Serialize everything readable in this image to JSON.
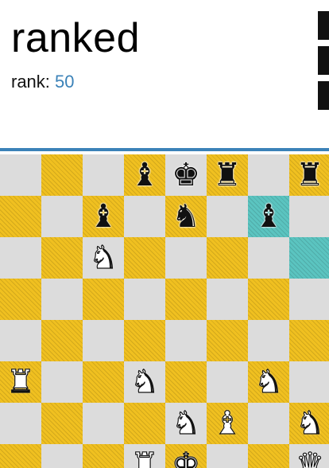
{
  "header": {
    "title": "ranked",
    "rank_label": "rank:",
    "rank_value": "50"
  },
  "colors": {
    "accent": "#3b82b8",
    "light_square": "#dcdcdc",
    "dark_square": "#f0c020",
    "highlight": "#5bc4c0"
  },
  "board": {
    "highlight_squares": [
      [
        1,
        6
      ],
      [
        2,
        7
      ]
    ],
    "pieces": [
      {
        "row": 0,
        "col": 3,
        "color": "black",
        "type": "bishop",
        "glyph": "♝",
        "icon": "black-bishop-icon"
      },
      {
        "row": 0,
        "col": 4,
        "color": "black",
        "type": "king",
        "glyph": "♚",
        "icon": "black-king-icon"
      },
      {
        "row": 0,
        "col": 5,
        "color": "black",
        "type": "rook",
        "glyph": "♜",
        "icon": "black-rook-icon"
      },
      {
        "row": 0,
        "col": 7,
        "color": "black",
        "type": "rook",
        "glyph": "♜",
        "icon": "black-rook-icon"
      },
      {
        "row": 1,
        "col": 2,
        "color": "black",
        "type": "bishop",
        "glyph": "♝",
        "icon": "black-bishop-icon"
      },
      {
        "row": 1,
        "col": 4,
        "color": "black",
        "type": "knight",
        "glyph": "♞",
        "icon": "black-knight-icon"
      },
      {
        "row": 1,
        "col": 6,
        "color": "black",
        "type": "bishop",
        "glyph": "♝",
        "icon": "black-bishop-icon"
      },
      {
        "row": 2,
        "col": 2,
        "color": "white",
        "type": "knight",
        "glyph": "♞",
        "icon": "white-knight-icon"
      },
      {
        "row": 5,
        "col": 0,
        "color": "white",
        "type": "rook",
        "glyph": "♜",
        "icon": "white-rook-icon"
      },
      {
        "row": 5,
        "col": 3,
        "color": "white",
        "type": "knight",
        "glyph": "♞",
        "icon": "white-knight-icon"
      },
      {
        "row": 5,
        "col": 6,
        "color": "white",
        "type": "knight",
        "glyph": "♞",
        "icon": "white-knight-icon"
      },
      {
        "row": 6,
        "col": 4,
        "color": "white",
        "type": "knight",
        "glyph": "♞",
        "icon": "white-knight-icon"
      },
      {
        "row": 6,
        "col": 5,
        "color": "white",
        "type": "bishop",
        "glyph": "♝",
        "icon": "white-bishop-icon"
      },
      {
        "row": 6,
        "col": 7,
        "color": "white",
        "type": "knight",
        "glyph": "♞",
        "icon": "white-knight-icon"
      },
      {
        "row": 7,
        "col": 3,
        "color": "white",
        "type": "rook",
        "glyph": "♜",
        "icon": "white-rook-icon"
      },
      {
        "row": 7,
        "col": 4,
        "color": "white",
        "type": "king",
        "glyph": "♚",
        "icon": "white-king-icon"
      },
      {
        "row": 7,
        "col": 7,
        "color": "white",
        "type": "queen",
        "glyph": "♛",
        "icon": "white-queen-icon"
      }
    ]
  }
}
